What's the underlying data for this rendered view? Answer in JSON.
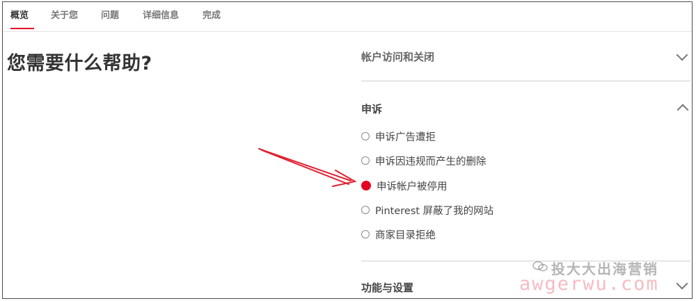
{
  "tabs": [
    {
      "label": "概览",
      "active": true
    },
    {
      "label": "关于您",
      "active": false
    },
    {
      "label": "问题",
      "active": false
    },
    {
      "label": "详细信息",
      "active": false
    },
    {
      "label": "完成",
      "active": false
    }
  ],
  "main": {
    "title": "您需要什么帮助?"
  },
  "accordion": {
    "section1": {
      "title": "帐户访问和关闭",
      "expanded": false
    },
    "section2": {
      "title": "申诉",
      "expanded": true,
      "options": [
        {
          "label": "申诉广告遭拒",
          "checked": false
        },
        {
          "label": "申诉因违规而产生的删除",
          "checked": false
        },
        {
          "label": "申诉帐户被停用",
          "checked": true
        },
        {
          "label": "Pinterest 屏蔽了我的网站",
          "checked": false
        },
        {
          "label": "商家目录拒绝",
          "checked": false
        }
      ]
    },
    "section3": {
      "title": "功能与设置",
      "expanded": false
    }
  },
  "watermark": {
    "line1": "投大大出海营销",
    "line2": "awgerwu.com"
  },
  "colors": {
    "accent": "#e60023",
    "annotation_arrow": "#e02030"
  }
}
